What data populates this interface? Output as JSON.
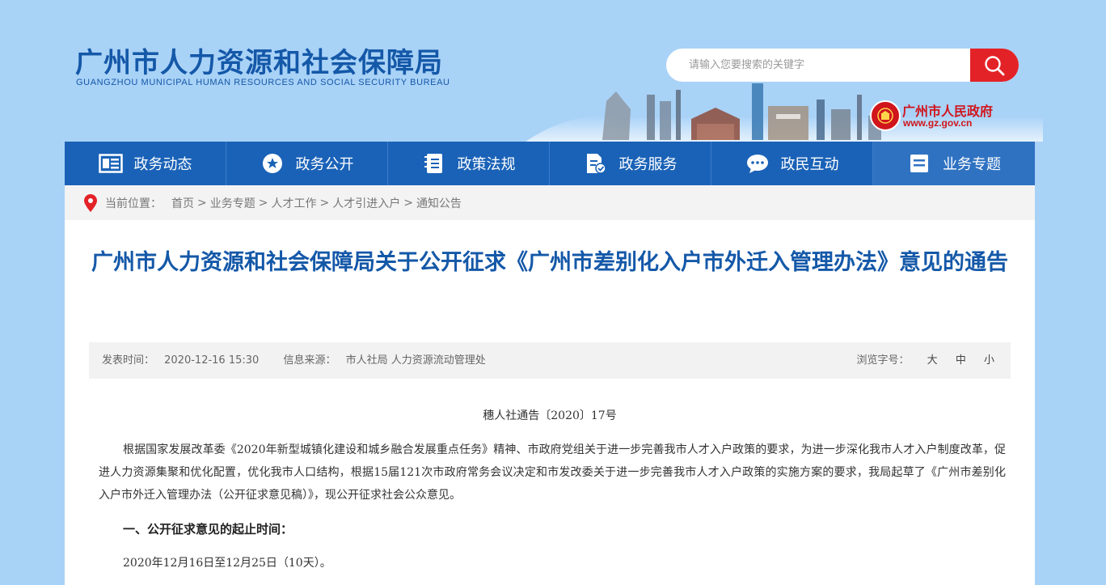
{
  "header": {
    "site_title": "广州市人力资源和社会保障局",
    "site_subtitle": "GUANGZHOU MUNICIPAL HUMAN RESOURCES AND SOCIAL SECURITY BUREAU",
    "search_placeholder": "请输入您要搜索的关键字",
    "gov_name": "广州市人民政府",
    "gov_url": "www.gz.gov.cn"
  },
  "nav": {
    "items": [
      {
        "label": "政务动态",
        "icon": "news-icon"
      },
      {
        "label": "政务公开",
        "icon": "star-icon"
      },
      {
        "label": "政策法规",
        "icon": "book-icon"
      },
      {
        "label": "政务服务",
        "icon": "document-icon"
      },
      {
        "label": "政民互动",
        "icon": "chat-icon"
      },
      {
        "label": "业务专题",
        "icon": "list-icon"
      }
    ]
  },
  "breadcrumb": {
    "label": "当前位置：",
    "items": [
      "首页",
      "业务专题",
      "人才工作",
      "人才引进入户",
      "通知公告"
    ],
    "separator": ">"
  },
  "article": {
    "title": "广州市人力资源和社会保障局关于公开征求《广州市差别化入户市外迁入管理办法》意见的通告",
    "publish_label": "发表时间：",
    "publish_time": "2020-12-16 15:30",
    "source_label": "信息来源：",
    "source": "市人社局 人力资源流动管理处",
    "font_size_label": "浏览字号：",
    "font_sizes": [
      "大",
      "中",
      "小"
    ],
    "doc_number": "穗人社通告〔2020〕17号",
    "paragraph": "根据国家发展改革委《2020年新型城镇化建设和城乡融合发展重点任务》精神、市政府党组关于进一步完善我市人才入户政策的要求，为进一步深化我市人才入户制度改革，促进人力资源集聚和优化配置，优化我市人口结构，根据15届121次市政府常务会议决定和市发改委关于进一步完善我市人才入户政策的实施方案的要求，我局起草了《广州市差别化入户市外迁入管理办法（公开征求意见稿）》，现公开征求社会公众意见。",
    "section1_heading": "一、公开征求意见的起止时间：",
    "section1_text": "2020年12月16日至12月25日（10天）。"
  },
  "colors": {
    "brand_blue": "#1458a8",
    "nav_blue": "#1a62b7",
    "search_red": "#e32228",
    "page_bg": "#a9d2f7"
  }
}
